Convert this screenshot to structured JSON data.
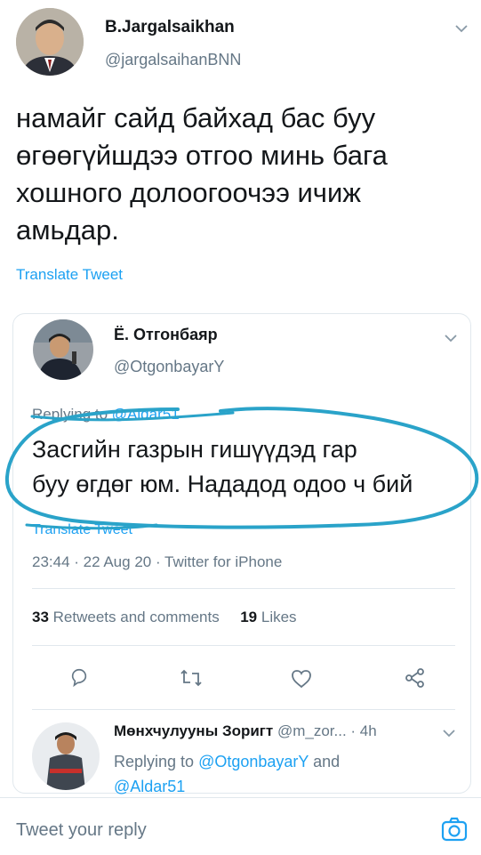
{
  "author": {
    "name": "B.Jargalsaikhan",
    "handle": "@jargalsaihanBNN"
  },
  "tweet": {
    "text_lines": [
      "намайг сайд байхад бас буу",
      "өгөөгүйшдээ отгоо минь бага",
      "хошного долоогоочээ ичиж",
      "амьдар."
    ],
    "translate": "Translate Tweet"
  },
  "quoted": {
    "name": "Ё. Отгонбаяр",
    "handle": "@OtgonbayarY",
    "replying_prefix": "Replying to",
    "replying_handle": "@Aldar51",
    "text_lines": [
      "Засгийн газрын гишүүдэд гар",
      "буу өгдөг юм. Нададод одоо ч бий"
    ],
    "translate": "Translate Tweet",
    "meta": "23:44 · 22 Aug 20 · Twitter for iPhone",
    "stats": {
      "retweets_count": "33",
      "retweets_label": "Retweets and comments",
      "likes_count": "19",
      "likes_label": "Likes"
    }
  },
  "reply": {
    "name": "Мөнхчулууны Зоригт",
    "handle": "@m_zor...",
    "time": "· 4h",
    "replying_prefix": "Replying to",
    "replying_to_1": "@OtgonbayarY",
    "and": "and",
    "replying_to_2": "@Aldar51"
  },
  "composer": {
    "placeholder": "Tweet your reply"
  },
  "colors": {
    "link": "#1da1f2",
    "muted": "#657786",
    "annotation": "#2aa3c9"
  }
}
